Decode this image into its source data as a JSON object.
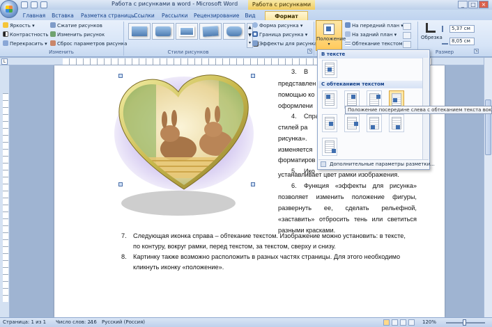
{
  "window": {
    "title": "Работа с рисунками в word - Microsoft Word",
    "context_title": "Работа с рисунками"
  },
  "tabs": [
    {
      "label": "Главная"
    },
    {
      "label": "Вставка"
    },
    {
      "label": "Разметка страницы"
    },
    {
      "label": "Ссылки"
    },
    {
      "label": "Рассылки"
    },
    {
      "label": "Рецензирование"
    },
    {
      "label": "Вид"
    },
    {
      "label": "Формат"
    }
  ],
  "ribbon": {
    "adjust": {
      "label": "Изменить",
      "brightness": "Яркость",
      "contrast": "Контрастность",
      "recolor": "Перекрасить",
      "compress": "Сжатие рисунков",
      "change": "Изменить рисунок",
      "reset": "Сброс параметров рисунка"
    },
    "styles": {
      "label": "Стили рисунков"
    },
    "style_side": {
      "shape": "Форма рисунка",
      "border": "Граница рисунка",
      "effects": "Эффекты для рисунка"
    },
    "arrange": {
      "position": "Положение",
      "front": "На передний план",
      "back": "На задний план",
      "wrap": "Обтекание текстом"
    },
    "size": {
      "crop": "Обрезка",
      "height": "5,37 см",
      "width": "8,05 см",
      "label": "Размер"
    }
  },
  "gallery": {
    "section_inline": "В тексте",
    "section_wrap": "С обтеканием текстом",
    "more": "Дополнительные параметры разметки...",
    "tooltip": "Положение посередине слева с обтеканием текста вокруг рамки"
  },
  "document": {
    "right_lines": [
      {
        "num": "3.",
        "text": "В"
      },
      {
        "text": "представлен"
      },
      {
        "text": "помощью ко"
      },
      {
        "text": "оформлени"
      },
      {
        "num": "4.",
        "text": "Спра"
      },
      {
        "text": "стилей    ра"
      },
      {
        "text": "рисунка»."
      },
      {
        "text": "изменяется"
      },
      {
        "text": "форматиров"
      },
      {
        "num": "5.",
        "text": "Ико"
      },
      {
        "text": "устанавливает цвет рамки изображения."
      },
      {
        "num": "6.",
        "text": "Функция «эффекты для рисунка»"
      },
      {
        "text": "позволяет    изменить положение фигуры,"
      },
      {
        "text": "развернуть    ее,    сделать    рельефной,"
      },
      {
        "text": "«заставить» отбросить тень или светиться"
      },
      {
        "text": "разными красками."
      }
    ],
    "list": [
      {
        "num": "7.",
        "lines": [
          "Следующая иконка справа – обтекание текстом. Изображение можно установить:  в тексте,",
          "по контуру, вокруг рамки, перед текстом,  за текстом, сверху и снизу."
        ]
      },
      {
        "num": "8.",
        "lines": [
          "Картинку также возможно расположить в разных частях страницы. Для этого необходимо",
          "кликнуть иконку «положение»."
        ]
      }
    ]
  },
  "status": {
    "page": "Страница: 1 из 1",
    "words": "Число слов: 216",
    "language": "Русский (Россия)",
    "zoom": "120%"
  },
  "colors": {
    "accent": "#ffc95a",
    "ribbon": "#d6e4f7",
    "frame": "#9fb4d2"
  }
}
